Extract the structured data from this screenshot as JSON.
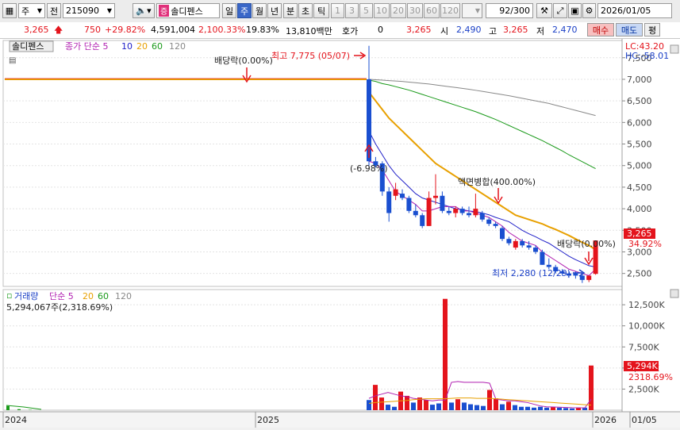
{
  "toolbar": {
    "mode_label": "주",
    "prev_label": "전",
    "code": "215090",
    "stock_badge": "증",
    "stock_name": "솔디펜스",
    "period_day": "일",
    "period_week": "주",
    "period_month": "월",
    "period_year": "년",
    "period_min": "분",
    "period_sec": "초",
    "period_tick": "틱",
    "intervals": [
      "1",
      "3",
      "5",
      "10",
      "20",
      "30",
      "60",
      "120"
    ],
    "count": "92",
    "count_total": "/300",
    "date": "2026/01/05"
  },
  "quote": {
    "price": "3,265",
    "change": "750",
    "change_pct": "+29.82%",
    "volume": "4,591,004",
    "volume_pct": "2,100.33%",
    "turnover_pct": "19.83%",
    "amount": "13,810백만",
    "hoga_label": "호가",
    "hoga_value": "0",
    "hoga_price": "3,265",
    "open_label": "시",
    "open": "2,490",
    "high_label": "고",
    "high": "3,265",
    "low_label": "저",
    "low": "2,470",
    "buy_label": "매수",
    "sell_label": "매도",
    "eval_label": "평"
  },
  "chart_data": [
    {
      "type": "candlestick",
      "title": "솔디펜스",
      "legend": [
        "종가 단순 5",
        "10",
        "20",
        "60",
        "120"
      ],
      "legend_colors": [
        "#b01fb0",
        "#2020c8",
        "#e8a000",
        "#1a9a1a",
        "#888888"
      ],
      "yticks": [
        "2,500",
        "3,000",
        "3,500",
        "4,000",
        "4,500",
        "5,000",
        "5,500",
        "6,000",
        "6,500",
        "7,000",
        "7,500"
      ],
      "ylim": [
        2200,
        7900
      ],
      "xticks": [
        "2024",
        "2025",
        "2026",
        "01/05"
      ],
      "lc_label": "LC:43.20",
      "hc_label": "HC:-58.01",
      "last_price_label": "3,265",
      "last_pct_label": "34.92%",
      "annotations": {
        "dividend1": "배당락(0.00%)",
        "high": "최고 7,775 (05/07)",
        "drop": "(-6.98%)",
        "split": "액면병합(400.00%)",
        "dividend2": "배당락(0.00%)",
        "low": "최저 2,280 (12/29)"
      },
      "flat_price": 7000,
      "candles": [
        {
          "o": 7000,
          "h": 7775,
          "l": 5000,
          "c": 5100
        },
        {
          "o": 5100,
          "h": 5200,
          "l": 4950,
          "c": 5000
        },
        {
          "o": 5050,
          "h": 5100,
          "l": 4300,
          "c": 4400
        },
        {
          "o": 4400,
          "h": 4500,
          "l": 3700,
          "c": 3900
        },
        {
          "o": 4300,
          "h": 4600,
          "l": 4200,
          "c": 4450
        },
        {
          "o": 4350,
          "h": 4450,
          "l": 4200,
          "c": 4250
        },
        {
          "o": 4250,
          "h": 4300,
          "l": 3900,
          "c": 3950
        },
        {
          "o": 3950,
          "h": 4100,
          "l": 3800,
          "c": 3850
        },
        {
          "o": 3850,
          "h": 3900,
          "l": 3550,
          "c": 3600
        },
        {
          "o": 3600,
          "h": 4400,
          "l": 3600,
          "c": 4250
        },
        {
          "o": 4250,
          "h": 4800,
          "l": 4100,
          "c": 4300
        },
        {
          "o": 4300,
          "h": 4400,
          "l": 3900,
          "c": 3950
        },
        {
          "o": 3950,
          "h": 4050,
          "l": 3850,
          "c": 3900
        },
        {
          "o": 3900,
          "h": 4050,
          "l": 3800,
          "c": 4000
        },
        {
          "o": 4000,
          "h": 4050,
          "l": 3850,
          "c": 3900
        },
        {
          "o": 3900,
          "h": 4050,
          "l": 3800,
          "c": 3850
        },
        {
          "o": 3850,
          "h": 4350,
          "l": 3800,
          "c": 4000
        },
        {
          "o": 3900,
          "h": 3950,
          "l": 3700,
          "c": 3750
        },
        {
          "o": 3750,
          "h": 3800,
          "l": 3600,
          "c": 3650
        },
        {
          "o": 3650,
          "h": 3700,
          "l": 3550,
          "c": 3600
        },
        {
          "o": 3550,
          "h": 3600,
          "l": 3250,
          "c": 3300
        },
        {
          "o": 3300,
          "h": 3350,
          "l": 3150,
          "c": 3200
        },
        {
          "o": 3100,
          "h": 3300,
          "l": 3050,
          "c": 3250
        },
        {
          "o": 3250,
          "h": 3300,
          "l": 3100,
          "c": 3150
        },
        {
          "o": 3150,
          "h": 3250,
          "l": 3050,
          "c": 3100
        },
        {
          "o": 3100,
          "h": 3150,
          "l": 2950,
          "c": 3000
        },
        {
          "o": 3000,
          "h": 3050,
          "l": 2700,
          "c": 2700
        },
        {
          "o": 2700,
          "h": 2850,
          "l": 2600,
          "c": 2650
        },
        {
          "o": 2650,
          "h": 2700,
          "l": 2500,
          "c": 2550
        },
        {
          "o": 2550,
          "h": 2600,
          "l": 2450,
          "c": 2500
        },
        {
          "o": 2500,
          "h": 2550,
          "l": 2400,
          "c": 2450
        },
        {
          "o": 2500,
          "h": 2550,
          "l": 2380,
          "c": 2450
        },
        {
          "o": 2450,
          "h": 2500,
          "l": 2280,
          "c": 2350
        },
        {
          "o": 2350,
          "h": 2450,
          "l": 2300,
          "c": 2450
        },
        {
          "o": 2490,
          "h": 3265,
          "l": 2470,
          "c": 3265
        }
      ],
      "ma5": [
        5100,
        5050,
        4900,
        4650,
        4400,
        4300,
        4200,
        4100,
        3950,
        3950,
        4000,
        4050,
        4050,
        4050,
        3950,
        3950,
        3900,
        3850,
        3800,
        3700,
        3600,
        3450,
        3350,
        3250,
        3200,
        3150,
        3000,
        2900,
        2800,
        2700,
        2600,
        2550,
        2500,
        2450,
        2600
      ],
      "ma10": [
        5800,
        5500,
        5250,
        5000,
        4800,
        4650,
        4500,
        4350,
        4250,
        4200,
        4150,
        4100,
        4050,
        4000,
        3980,
        3950,
        3930,
        3900,
        3860,
        3800,
        3750,
        3700,
        3600,
        3500,
        3420,
        3350,
        3270,
        3200,
        3100,
        3000,
        2900,
        2820,
        2750,
        2680,
        2650
      ],
      "ma20": [
        6700,
        6500,
        6300,
        6100,
        5950,
        5800,
        5650,
        5500,
        5350,
        5200,
        5050,
        4950,
        4850,
        4750,
        4650,
        4550,
        4450,
        4350,
        4250,
        4150,
        4050,
        3950,
        3850,
        3800,
        3750,
        3700,
        3650,
        3580,
        3520,
        3450,
        3380,
        3300,
        3220,
        3150,
        3050
      ],
      "ma60": [
        6980,
        6950,
        6900,
        6870,
        6830,
        6790,
        6750,
        6700,
        6650,
        6600,
        6550,
        6500,
        6450,
        6400,
        6350,
        6300,
        6250,
        6190,
        6130,
        6070,
        6000,
        5930,
        5860,
        5790,
        5720,
        5650,
        5580,
        5500,
        5420,
        5340,
        5250,
        5170,
        5090,
        5010,
        4930
      ],
      "ma120": [
        7000,
        6990,
        6980,
        6970,
        6960,
        6950,
        6935,
        6920,
        6905,
        6890,
        6870,
        6850,
        6830,
        6810,
        6790,
        6770,
        6745,
        6720,
        6695,
        6670,
        6645,
        6620,
        6590,
        6560,
        6530,
        6500,
        6470,
        6440,
        6400,
        6360,
        6320,
        6280,
        6240,
        6200,
        6160
      ]
    },
    {
      "type": "bar",
      "title": "거래량",
      "legend": [
        "단순 5",
        "20",
        "60",
        "120"
      ],
      "legend_colors": [
        "#b01fb0",
        "#e8a000",
        "#1a9a1a",
        "#888888"
      ],
      "summary_label": "5,294,067주(2,318.69%)",
      "yticks": [
        "2,500K",
        "5,000K",
        "7,500K",
        "10,000K",
        "12,500K"
      ],
      "ylim": [
        0,
        14300
      ],
      "last_volume_label": "5,294K",
      "last_pct_label": "2318.69%",
      "early_volume": [
        500,
        120,
        40,
        0
      ],
      "volume": [
        1200,
        3000,
        1500,
        650,
        400,
        2200,
        1700,
        900,
        1500,
        1200,
        650,
        800,
        13200,
        900,
        1300,
        900,
        700,
        600,
        500,
        2400,
        1400,
        700,
        1000,
        600,
        400,
        400,
        300,
        400,
        300,
        350,
        300,
        250,
        200,
        300,
        300,
        5294
      ],
      "up": [
        false,
        true,
        true,
        false,
        false,
        true,
        true,
        false,
        true,
        true,
        false,
        false,
        true,
        false,
        true,
        false,
        false,
        false,
        false,
        true,
        true,
        false,
        true,
        false,
        false,
        false,
        false,
        false,
        false,
        true,
        false,
        false,
        false,
        true,
        false,
        true
      ],
      "ma5": [
        1400,
        1700,
        1900,
        2100,
        1900,
        1700,
        1600,
        1400,
        1300,
        1200,
        1100,
        1200,
        1200,
        3300,
        3400,
        3300,
        3300,
        3300,
        3300,
        3200,
        1300,
        1200,
        1100,
        1100,
        1000,
        900,
        700,
        500,
        400,
        380,
        350,
        320,
        290,
        280,
        270,
        1300
      ],
      "ma20": [
        800,
        900,
        950,
        1000,
        1050,
        1100,
        1150,
        1250,
        1300,
        1350,
        1350,
        1350,
        1350,
        1400,
        1450,
        1450,
        1450,
        1400,
        1400,
        1400,
        1350,
        1300,
        1250,
        1200,
        1150,
        1100,
        1050,
        1000,
        950,
        900,
        850,
        800,
        750,
        700,
        650,
        600
      ]
    }
  ]
}
